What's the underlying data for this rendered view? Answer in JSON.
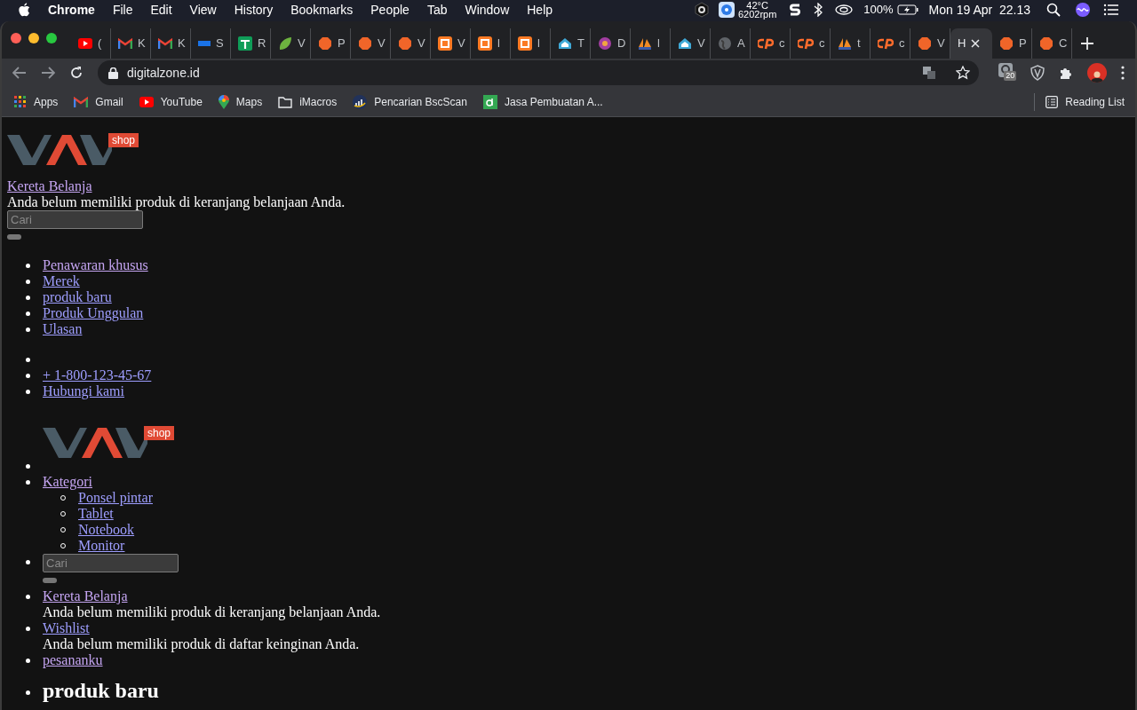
{
  "menubar": {
    "app": "Chrome",
    "menus": [
      "File",
      "Edit",
      "View",
      "History",
      "Bookmarks",
      "People",
      "Tab",
      "Window",
      "Help"
    ],
    "temperature": "42°C",
    "fan_speed": "6202rpm",
    "battery": "100%",
    "clock": "Mon 19 Apr  22.13"
  },
  "tabs": [
    {
      "kind": "youtube",
      "title": "(",
      "selected": false
    },
    {
      "kind": "gmail",
      "title": "K",
      "selected": false
    },
    {
      "kind": "gmail",
      "title": "K",
      "selected": false
    },
    {
      "kind": "bar",
      "title": "S",
      "selected": false
    },
    {
      "kind": "sheet",
      "title": "R",
      "selected": false
    },
    {
      "kind": "leaf",
      "title": "V",
      "selected": false
    },
    {
      "kind": "octagon",
      "title": "P",
      "selected": false
    },
    {
      "kind": "octagon",
      "title": "V",
      "selected": false
    },
    {
      "kind": "octagon",
      "title": "V",
      "selected": false
    },
    {
      "kind": "xampp",
      "title": "V",
      "selected": false
    },
    {
      "kind": "xampp",
      "title": "l",
      "selected": false
    },
    {
      "kind": "xampp",
      "title": "l",
      "selected": false
    },
    {
      "kind": "house",
      "title": "T",
      "selected": false
    },
    {
      "kind": "flower",
      "title": "D",
      "selected": false
    },
    {
      "kind": "sails",
      "title": "l",
      "selected": false
    },
    {
      "kind": "house",
      "title": "V",
      "selected": false
    },
    {
      "kind": "globe",
      "title": "A",
      "selected": false
    },
    {
      "kind": "cpanel",
      "title": "c",
      "selected": false
    },
    {
      "kind": "cpanel",
      "title": "c",
      "selected": false
    },
    {
      "kind": "sails",
      "title": "t",
      "selected": false
    },
    {
      "kind": "cpanel",
      "title": "c",
      "selected": false
    },
    {
      "kind": "octagon",
      "title": "V",
      "selected": false
    },
    {
      "kind": "none",
      "title": "H",
      "selected": true
    },
    {
      "kind": "octagon",
      "title": "P",
      "selected": false
    },
    {
      "kind": "octagon",
      "title": "C",
      "selected": false
    }
  ],
  "toolbar": {
    "url": "digitalzone.id",
    "extension_badge": "20"
  },
  "bookmarks": [
    {
      "kind": "apps",
      "label": "Apps"
    },
    {
      "kind": "gmail",
      "label": "Gmail"
    },
    {
      "kind": "youtube",
      "label": "YouTube"
    },
    {
      "kind": "maps",
      "label": "Maps"
    },
    {
      "kind": "folder",
      "label": "iMacros"
    },
    {
      "kind": "bsc",
      "label": "Pencarian BscScan"
    },
    {
      "kind": "d",
      "label": "Jasa Pembuatan A..."
    }
  ],
  "reading_list": "Reading List",
  "page": {
    "header": {
      "logo_tag": "shop",
      "cart_link": {
        "label": "Kereta Belanja",
        "visited": true
      },
      "cart_message": "Anda belum memiliki produk di keranjang belanjaan Anda.",
      "search": {
        "placeholder": "Cari"
      }
    },
    "menu": [
      {
        "label": "Penawaran khusus",
        "visited": true
      },
      {
        "label": "Merek",
        "visited": false
      },
      {
        "label": "produk baru",
        "visited": false
      },
      {
        "label": "Produk Unggulan",
        "visited": false
      },
      {
        "label": "Ulasan",
        "visited": false
      }
    ],
    "contact": [
      {
        "label": "+ 1-800-123-45-67",
        "visited": false
      },
      {
        "label": "Hubungi kami",
        "visited": false
      }
    ],
    "nav": {
      "logo_tag": "shop",
      "category": {
        "label": "Kategori",
        "visited": true,
        "children": [
          {
            "label": "Ponsel pintar",
            "visited": false
          },
          {
            "label": "Tablet",
            "visited": false
          },
          {
            "label": "Notebook",
            "visited": false
          },
          {
            "label": "Monitor",
            "visited": false
          }
        ]
      },
      "search": {
        "placeholder": "Cari"
      },
      "cart": {
        "label": "Kereta Belanja",
        "visited": true,
        "message": "Anda belum memiliki produk di keranjang belanjaan Anda."
      },
      "wishlist": {
        "label": "Wishlist",
        "visited": false,
        "message": "Anda belum memiliki produk di daftar keinginan Anda."
      },
      "orders": {
        "label": "pesananku",
        "visited": true
      }
    },
    "section_heading": "produk baru"
  }
}
